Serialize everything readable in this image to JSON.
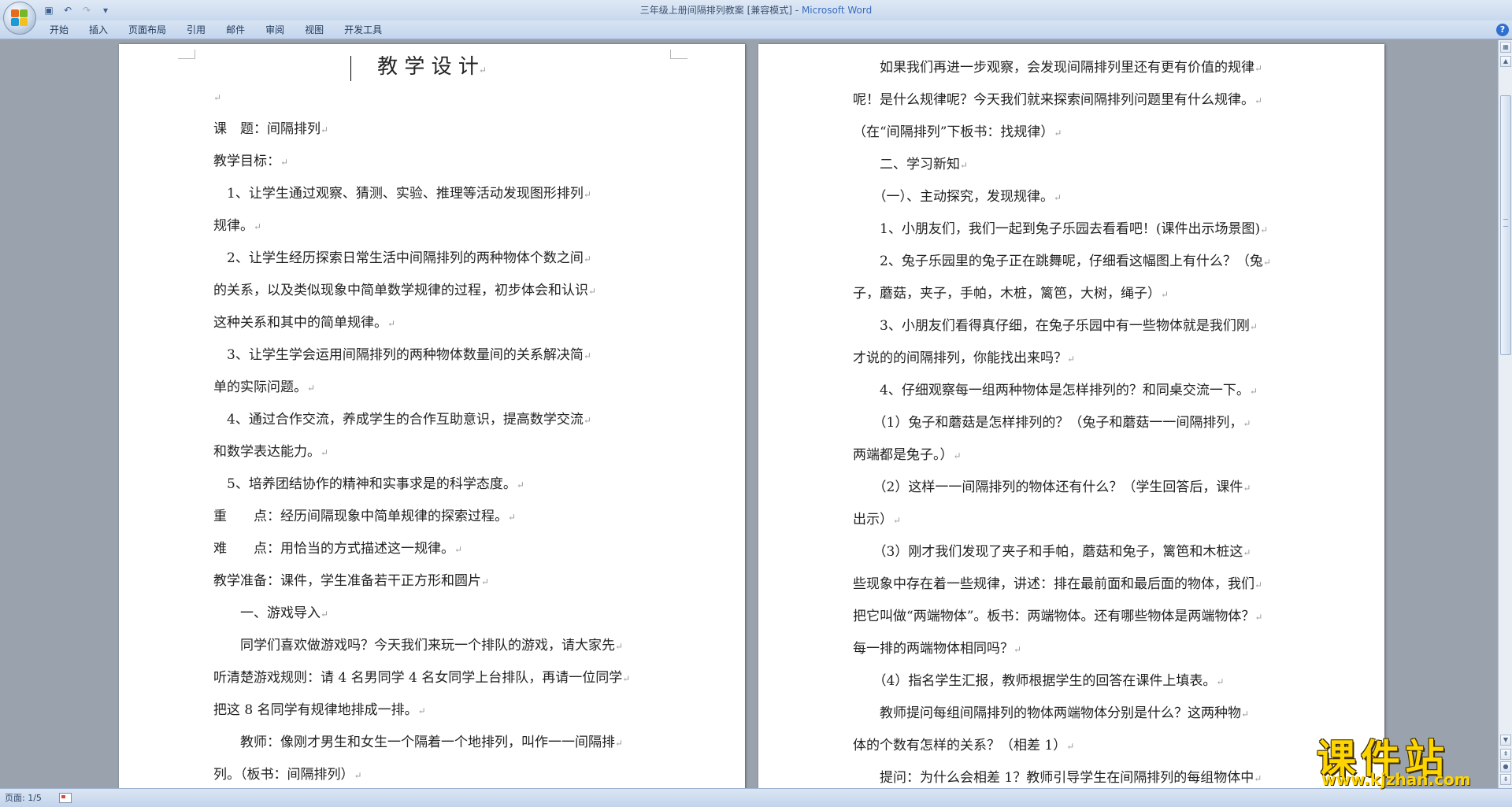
{
  "window": {
    "doc_name": "三年级上册间隔排列教案 [兼容模式]",
    "separator": " - ",
    "app_name": "Microsoft Word"
  },
  "quick_access": {
    "save_icon": "save-icon",
    "undo_icon": "undo-icon",
    "redo_icon": "redo-icon",
    "customize_icon": "customize-arrow-icon"
  },
  "ribbon": {
    "tabs": [
      "开始",
      "插入",
      "页面布局",
      "引用",
      "邮件",
      "审阅",
      "视图",
      "开发工具"
    ],
    "help": "?"
  },
  "left_page": {
    "title": "教 学 设 计",
    "lines": [
      "",
      "课　题：间隔排列",
      "教学目标：",
      "　1、让学生通过观察、猜测、实验、推理等活动发现图形排列",
      "规律。",
      "　2、让学生经历探索日常生活中间隔排列的两种物体个数之间",
      "的关系，以及类似现象中简单数学规律的过程，初步体会和认识",
      "这种关系和其中的简单规律。",
      "　3、让学生学会运用间隔排列的两种物体数量间的关系解决简",
      "单的实际问题。",
      "　4、通过合作交流，养成学生的合作互助意识，提高数学交流",
      "和数学表达能力。",
      "　5、培养团结协作的精神和实事求是的科学态度。",
      "重　　点：经历间隔现象中简单规律的探索过程。",
      "难　　点：用恰当的方式描述这一规律。",
      "教学准备：课件，学生准备若干正方形和圆片",
      "　　一、游戏导入",
      "　　同学们喜欢做游戏吗？今天我们来玩一个排队的游戏，请大家先",
      "听清楚游戏规则：请 4 名男同学 4 名女同学上台排队，再请一位同学",
      "把这 8 名同学有规律地排成一排。",
      "　　教师：像刚才男生和女生一个隔着一个地排列，叫作一一间隔排",
      "列。（板书：间隔排列）"
    ]
  },
  "right_page": {
    "lines": [
      "　　如果我们再进一步观察，会发现间隔排列里还有更有价值的规律",
      "呢！是什么规律呢？今天我们就来探索间隔排列问题里有什么规律。",
      "（在“间隔排列”下板书：找规律）",
      "　　二、学习新知",
      "　　（一）、主动探究，发现规律。",
      "　　1、小朋友们，我们一起到兔子乐园去看看吧！(课件出示场景图)",
      "　　2、兔子乐园里的兔子正在跳舞呢，仔细看这幅图上有什么？（兔",
      "子，蘑菇，夹子，手帕，木桩，篱笆，大树，绳子）",
      "　　3、小朋友们看得真仔细，在兔子乐园中有一些物体就是我们刚",
      "才说的的间隔排列，你能找出来吗？",
      "　　4、仔细观察每一组两种物体是怎样排列的？和同桌交流一下。",
      "　　（1）兔子和蘑菇是怎样排列的？（兔子和蘑菇一一间隔排列，",
      "两端都是兔子。）",
      "　　（2）这样一一间隔排列的物体还有什么？（学生回答后，课件",
      "出示）",
      "　　（3）刚才我们发现了夹子和手帕，蘑菇和兔子，篱笆和木桩这",
      "些现象中存在着一些规律，讲述：排在最前面和最后面的物体，我们",
      "把它叫做“两端物体”。板书：两端物体。还有哪些物体是两端物体？",
      "每一排的两端物体相同吗？",
      "　　（4）指名学生汇报，教师根据学生的回答在课件上填表。",
      "　　教师提问每组间隔排列的物体两端物体分别是什么？这两种物",
      "体的个数有怎样的关系？（相差 1）",
      "　　提问：为什么会相差 1？教师引导学生在间隔排列的每组物体中"
    ]
  },
  "paragraph_mark": "↵",
  "status": {
    "page": "页面: 1/5"
  },
  "watermark": {
    "text": "课件站",
    "url": "www.kjzhan.com"
  }
}
